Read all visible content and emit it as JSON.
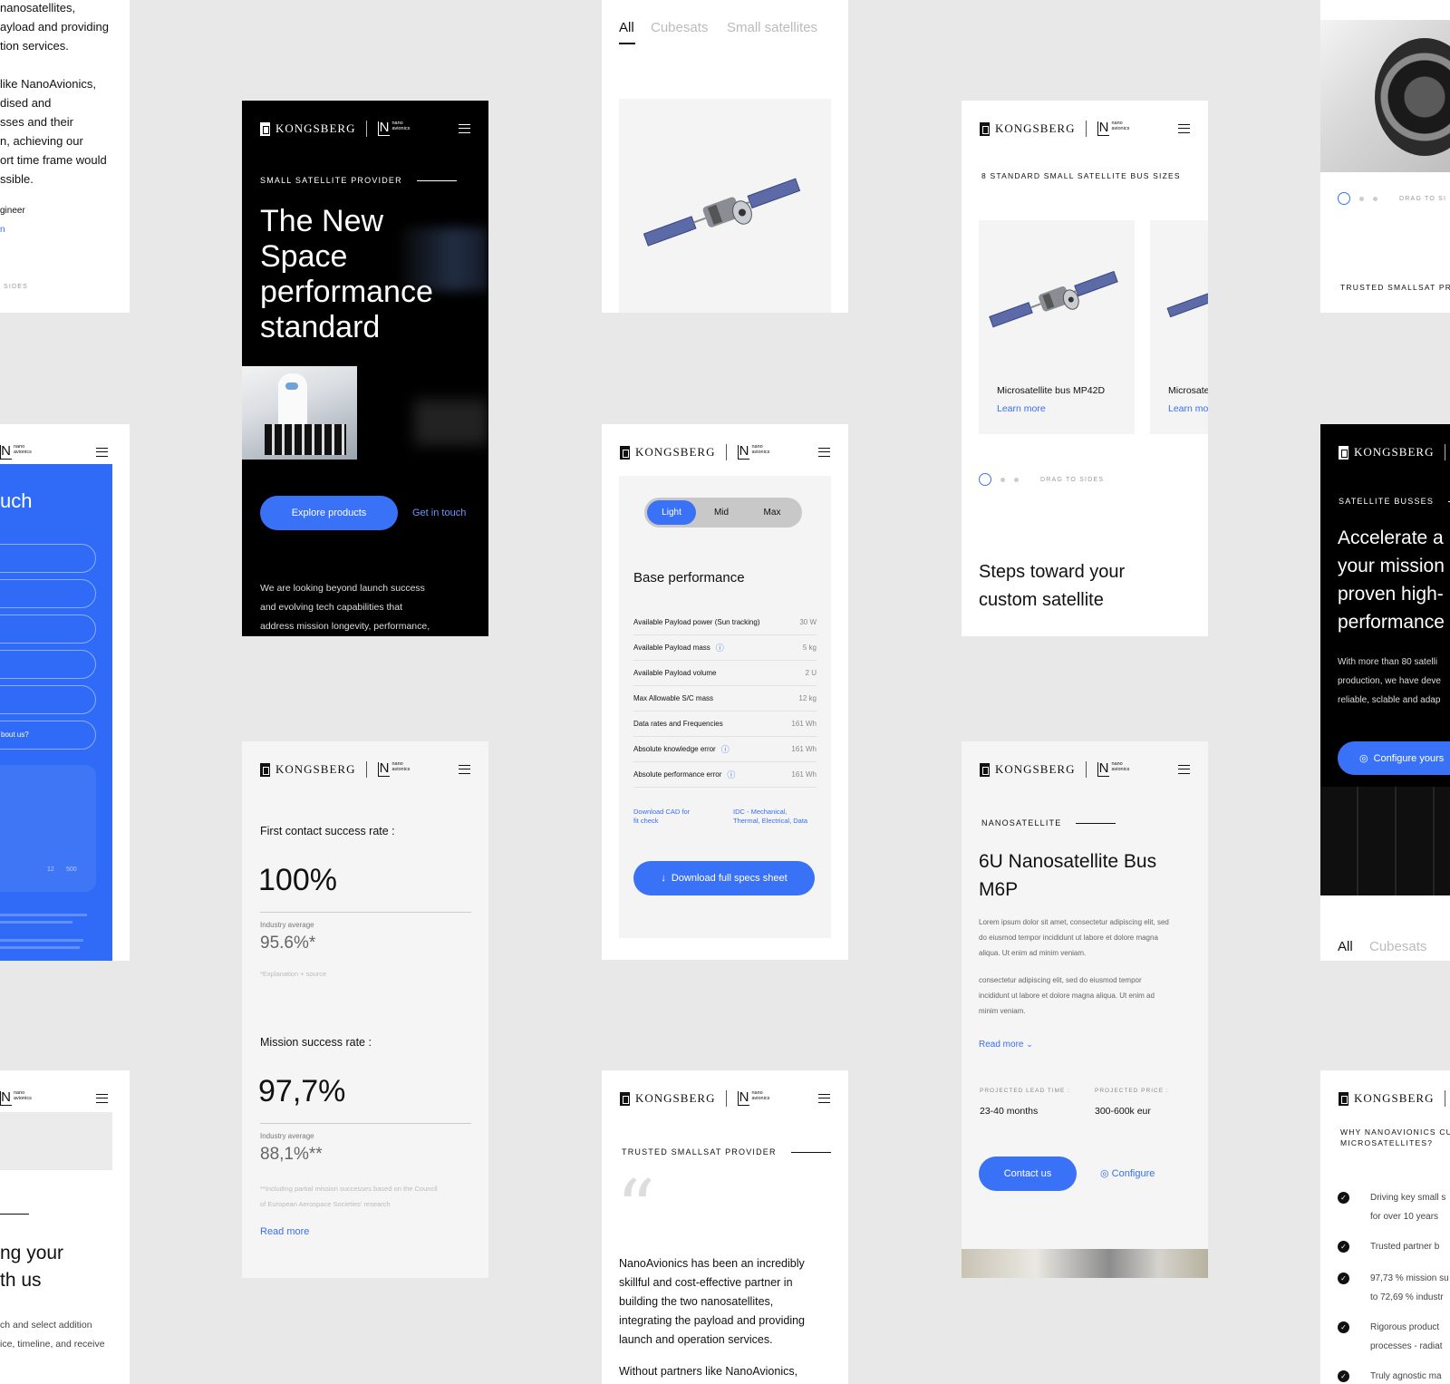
{
  "brand": {
    "kongsberg": "KONGSBERG",
    "nano_line1": "nano",
    "nano_line2": "avionics",
    "n_mark": "N"
  },
  "left_top": {
    "lines": [
      "nanosatellites,",
      "ayload and providing",
      "tion services.",
      "",
      "like NanoAvionics,",
      "dised and",
      "sses and their",
      "n, achieving our",
      "ort time frame would",
      "ssible."
    ],
    "role": "gineer",
    "link": "n",
    "footer": "SIDES"
  },
  "hero": {
    "eyebrow": "SMALL SATELLITE PROVIDER",
    "title_lines": [
      "The New",
      "Space",
      "performance",
      "standard"
    ],
    "cta_primary": "Explore products",
    "cta_secondary": "Get in touch",
    "body_lines": [
      "We are looking beyond launch success",
      "and evolving tech capabilities that",
      "address mission longevity, performance,"
    ]
  },
  "filter_card": {
    "tabs": [
      "All",
      "Cubesats",
      "Small satellites"
    ]
  },
  "bus_sizes": {
    "eyebrow": "8 STANDARD SMALL SATELLITE BUS SIZES",
    "item1_name": "Microsatellite bus MP42D",
    "item1_link": "Learn more",
    "item2_name": "Microsate",
    "item2_link": "Learn mo",
    "drag": "DRAG TO SIDES",
    "heading_lines": [
      "Steps toward your",
      "custom satellite"
    ]
  },
  "right_top": {
    "drag": "DRAG TO SI",
    "eyebrow": "TRUSTED SMALLSAT PROV"
  },
  "left_blue": {
    "title": "uch",
    "question": "bout us?",
    "counter_a": "12",
    "counter_b": "500"
  },
  "specs": {
    "levels": [
      "Light",
      "Mid",
      "Max"
    ],
    "heading": "Base performance",
    "rows": [
      {
        "label": "Available Payload power (Sun tracking)",
        "value": "30 W",
        "info": false
      },
      {
        "label": "Available Payload mass",
        "value": "5 kg",
        "info": true
      },
      {
        "label": "Available Payload volume",
        "value": "2 U",
        "info": false
      },
      {
        "label": "Max Allowable S/C mass",
        "value": "12 kg",
        "info": false
      },
      {
        "label": "Data rates and Frequencies",
        "value": "161 Wh",
        "info": false
      },
      {
        "label": "Absolute knowledge error",
        "value": "161 Wh",
        "info": true
      },
      {
        "label": "Absolute performance error",
        "value": "161 Wh",
        "info": true
      }
    ],
    "link_a_lines": [
      "Download CAD for",
      "fit check"
    ],
    "link_b_lines": [
      "IDC - Mechanical,",
      "Thermal, Electrical, Data"
    ],
    "download": "Download full specs sheet"
  },
  "accelerate": {
    "eyebrow": "SATELLITE BUSSES",
    "title_lines": [
      "Accelerate a",
      "your mission",
      "proven high-",
      "performance"
    ],
    "body_lines": [
      "With more than 80 satelli",
      "production, we have deve",
      "reliable, sclable and adap"
    ],
    "cta": "Configure yours",
    "tabs": [
      "All",
      "Cubesats"
    ]
  },
  "stats": {
    "label1": "First contact success rate :",
    "value1": "100%",
    "avg_label": "Industry average",
    "avg1": "95.6%*",
    "note1": "*Explanation + source",
    "label2": "Mission success rate :",
    "value2": "97,7%",
    "avg2": "88,1%**",
    "note2_lines": [
      "**Including partial mission successes based on the Council",
      "of European Aerospace Societies' research"
    ],
    "link": "Read more"
  },
  "product": {
    "eyebrow": "NANOSATELLITE",
    "title_lines": [
      "6U Nanosatellite Bus",
      "M6P"
    ],
    "para1_lines": [
      "Lorem ipsum dolor sit amet, consectetur adipiscing elit, sed",
      "do eiusmod tempor incididunt ut labore et dolore magna",
      "aliqua. Ut enim ad minim veniam."
    ],
    "para2_lines": [
      "consectetur adipiscing elit, sed do eiusmod tempor",
      "incididunt ut labore et dolore magna aliqua. Ut enim ad",
      "minim veniam."
    ],
    "read_more": "Read more",
    "lead_label": "PROJECTED LEAD TIME :",
    "lead_value": "23-40 months",
    "price_label": "PROJECTED PRICE :",
    "price_value": "300-600k eur",
    "contact": "Contact us",
    "configure": "Configure"
  },
  "left_bottom": {
    "title_lines": [
      "ng your",
      "th us"
    ],
    "body_lines": [
      "ch and select addition",
      "ice, timeline, and receive"
    ]
  },
  "quote": {
    "eyebrow": "TRUSTED SMALLSAT PROVIDER",
    "mark": "“",
    "lines": [
      "NanoAvionics has been an incredibly",
      "skillful and cost-effective partner in",
      "building the two nanosatellites,",
      "integrating the payload and providing",
      "launch and operation services."
    ],
    "tail": "Without partners like NanoAvionics,"
  },
  "why": {
    "heading_lines": [
      "WHY NANOAVIONICS CUB",
      "MICROSATELLITES?"
    ],
    "items": [
      [
        "Driving key small s",
        "for over 10 years"
      ],
      [
        "Trusted partner b"
      ],
      [
        "97,73 % mission su",
        "to 72,69 % industr"
      ],
      [
        "Rigorous product",
        "processes - radiat"
      ],
      [
        "Truly agnostic ma"
      ]
    ]
  }
}
